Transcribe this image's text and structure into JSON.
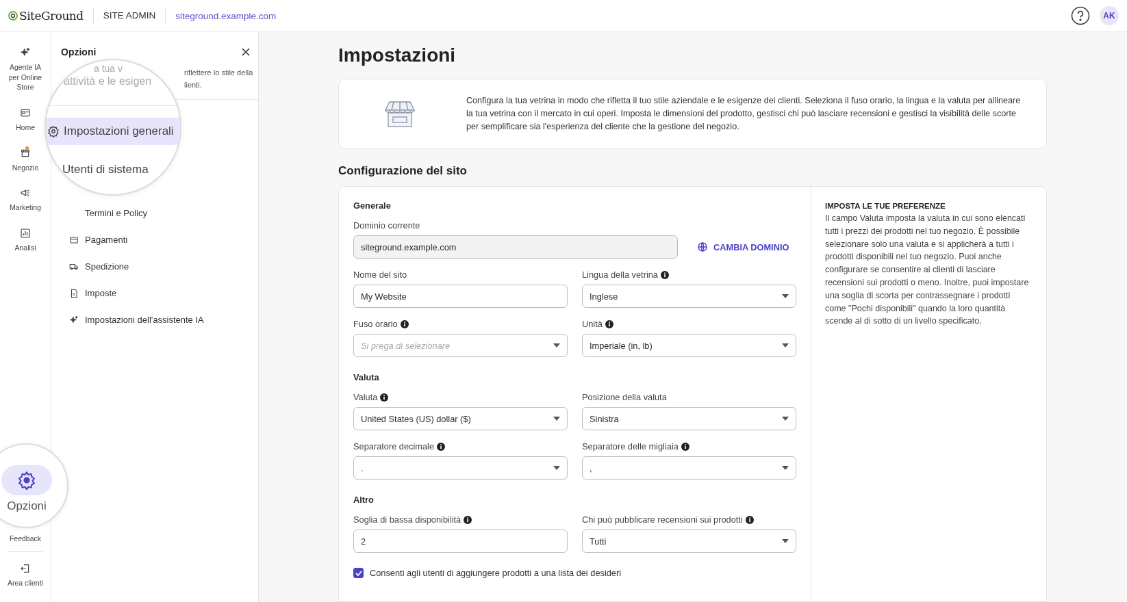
{
  "topbar": {
    "logo": "SiteGround",
    "section": "SITE ADMIN",
    "domain": "siteground.example.com",
    "avatar": "AK"
  },
  "rail": {
    "items": [
      {
        "label": "Agente IA per Online Store",
        "selected": false,
        "dot": false
      },
      {
        "label": "Home",
        "selected": false,
        "dot": false
      },
      {
        "label": "Negozio",
        "selected": false,
        "dot": true
      },
      {
        "label": "Marketing",
        "selected": false,
        "dot": false
      },
      {
        "label": "Analisi",
        "selected": false,
        "dot": false
      }
    ],
    "options": {
      "label": "Opzioni",
      "selected": true
    },
    "feedback": "Feedback",
    "exit": "Area clienti"
  },
  "panel": {
    "title": "Opzioni",
    "description_lines": [
      "riflettere lo stile della",
      "lienti."
    ],
    "lens_lines": [
      "a tua v",
      "attività e le esigen"
    ],
    "items": [
      {
        "label": "Impostazioni generali",
        "selected": true
      },
      {
        "label": "Utenti di sistema",
        "selected": false
      },
      {
        "label": "Termini e Policy",
        "selected": false
      },
      {
        "label": "Pagamenti",
        "selected": false
      },
      {
        "label": "Spedizione",
        "selected": false
      },
      {
        "label": "Imposte",
        "selected": false
      },
      {
        "label": "Impostazioni dell'assistente IA",
        "selected": false
      }
    ]
  },
  "page": {
    "title": "Impostazioni",
    "intro": "Configura la tua vetrina in modo che rifletta il tuo stile aziendale e le esigenze dei clienti. Seleziona il fuso orario, la lingua e la valuta per allineare la tua vetrina con il mercato in cui operi. Imposta le dimensioni del prodotto, gestisci chi può lasciare recensioni e gestisci la visibilità delle scorte per semplificare sia l'esperienza del cliente che la gestione del negozio.",
    "section_title": "Configurazione del sito",
    "groups": [
      {
        "title": "Generale",
        "fields": [
          {
            "kind": "domain",
            "label": "Dominio corrente",
            "info": false,
            "value": "siteground.example.com",
            "action": "CAMBIA DOMINIO"
          },
          {
            "kind": "input",
            "label": "Nome del sito",
            "info": false,
            "value": "My Website"
          },
          {
            "kind": "select",
            "label": "Lingua della vetrina",
            "info": true,
            "value": "Inglese"
          },
          {
            "kind": "select",
            "label": "Fuso orario",
            "info": true,
            "placeholder": "Si prega di selezionare"
          },
          {
            "kind": "select",
            "label": "Unità",
            "info": true,
            "value": "Imperiale (in, lb)"
          }
        ]
      },
      {
        "title": "Valuta",
        "fields": [
          {
            "kind": "select",
            "label": "Valuta",
            "info": true,
            "value": "United States (US) dollar ($)"
          },
          {
            "kind": "select",
            "label": "Posizione della valuta",
            "info": false,
            "value": "Sinistra"
          },
          {
            "kind": "select",
            "label": "Separatore decimale",
            "info": true,
            "value": "."
          },
          {
            "kind": "select",
            "label": "Separatore delle migliaia",
            "info": true,
            "value": ","
          }
        ]
      },
      {
        "title": "Altro",
        "fields": [
          {
            "kind": "input",
            "label": "Soglia di bassa disponibilità",
            "info": true,
            "value": "2"
          },
          {
            "kind": "select",
            "label": "Chi può pubblicare recensioni sui prodotti",
            "info": true,
            "value": "Tutti"
          }
        ]
      }
    ],
    "checkboxes": [
      {
        "label": "Consenti agli utenti di aggiungere prodotti a una lista dei desideri",
        "checked": true
      }
    ],
    "help": {
      "title": "IMPOSTA LE TUE PREFERENZE",
      "text": "Il campo Valuta imposta la valuta in cui sono elencati tutti i prezzi dei prodotti nel tuo negozio. È possibile selezionare solo una valuta e si applicherà a tutti i prodotti disponibili nel tuo negozio. Puoi anche configurare se consentire ai clienti di lasciare recensioni sui prodotti o meno. Inoltre, puoi impostare una soglia di scorta per contrassegnare i prodotti come \"Pochi disponibili\" quando la loro quantità scende al di sotto di un livello specificato."
    }
  }
}
